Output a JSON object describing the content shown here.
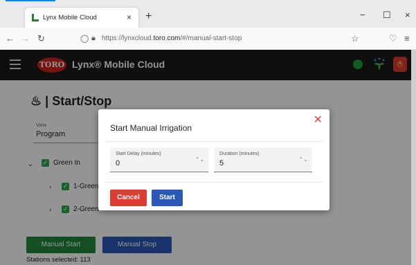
{
  "browser": {
    "tab_title": "Lynx Mobile Cloud",
    "tab_close": "×",
    "new_tab": "+",
    "url_prefix": "https://lynxcloud.",
    "url_domain": "toro.com",
    "url_suffix": "/#/manual-start-stop",
    "minimize": "−",
    "maximize": "☐",
    "close": "×"
  },
  "header": {
    "logo_text": "TORO",
    "title": "Lynx® Mobile Cloud",
    "status_color": "#1e9c3a"
  },
  "page": {
    "title_icon": "♨",
    "title": "| Start/Stop",
    "view_label": "View",
    "view_value": "Program",
    "tree": {
      "root_label": "Green In",
      "items": [
        {
          "label": "1-Green"
        },
        {
          "label": "2-Green"
        }
      ]
    },
    "manual_start_label": "Manual Start",
    "manual_stop_label": "Manual Stop",
    "stations_selected": "Stations selected: 113"
  },
  "modal": {
    "title": "Start Manual Irrigation",
    "start_delay": {
      "label": "Start Delay (minutes)",
      "value": "0"
    },
    "duration": {
      "label": "Duration (minutes)",
      "value": "5"
    },
    "cancel_label": "Cancel",
    "start_label": "Start"
  },
  "colors": {
    "accent_red": "#df3b32",
    "accent_blue": "#2a58b7",
    "accent_green": "#1f8a3f"
  }
}
